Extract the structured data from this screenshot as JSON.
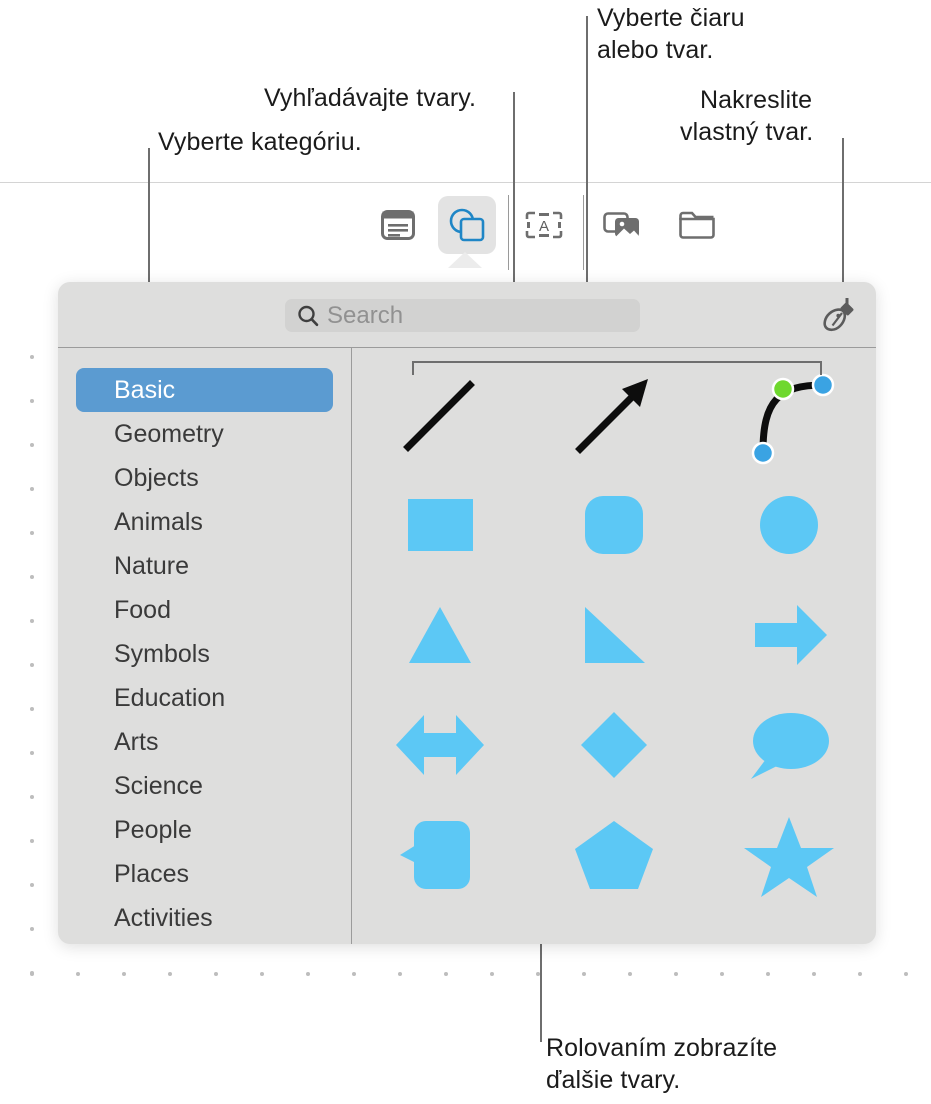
{
  "annotations": {
    "select_category": "Vyberte kategóriu.",
    "search_shapes": "Vyhľadávajte tvary.",
    "select_line_or_shape_l1": "Vyberte čiaru",
    "select_line_or_shape_l2": "alebo tvar.",
    "draw_custom_l1": "Nakreslite",
    "draw_custom_l2": "vlastný tvar.",
    "scroll_more_l1": "Rolovaním zobrazíte",
    "scroll_more_l2": "ďalšie tvary."
  },
  "toolbar": {
    "buttons": [
      {
        "name": "text-button",
        "icon": "text-box-icon",
        "selected": false
      },
      {
        "name": "shape-button",
        "icon": "shapes-icon",
        "selected": true
      },
      {
        "name": "text-box-button",
        "icon": "text-frame-icon",
        "selected": false
      },
      {
        "name": "media-button",
        "icon": "media-icon",
        "selected": false
      },
      {
        "name": "collections-button",
        "icon": "folder-icon",
        "selected": false
      }
    ]
  },
  "panel": {
    "search": {
      "placeholder": "Search",
      "value": "",
      "icon": "search-icon"
    },
    "draw_tool": {
      "name": "draw-shape-button",
      "icon": "pen-nib-icon"
    },
    "sidebar": {
      "items": [
        {
          "label": "Basic",
          "selected": true
        },
        {
          "label": "Geometry",
          "selected": false
        },
        {
          "label": "Objects",
          "selected": false
        },
        {
          "label": "Animals",
          "selected": false
        },
        {
          "label": "Nature",
          "selected": false
        },
        {
          "label": "Food",
          "selected": false
        },
        {
          "label": "Symbols",
          "selected": false
        },
        {
          "label": "Education",
          "selected": false
        },
        {
          "label": "Arts",
          "selected": false
        },
        {
          "label": "Science",
          "selected": false
        },
        {
          "label": "People",
          "selected": false
        },
        {
          "label": "Places",
          "selected": false
        },
        {
          "label": "Activities",
          "selected": false
        }
      ]
    },
    "shapes": {
      "rows": [
        [
          "line-shape",
          "arrow-shape",
          "bezier-curve-shape"
        ],
        [
          "square-shape",
          "rounded-square-shape",
          "circle-shape"
        ],
        [
          "triangle-shape",
          "right-triangle-shape",
          "right-arrow-shape"
        ],
        [
          "double-arrow-shape",
          "diamond-shape",
          "speech-bubble-shape"
        ],
        [
          "callout-rounded-rect-shape",
          "pentagon-shape",
          "star-shape"
        ]
      ]
    }
  },
  "colors": {
    "shape_fill": "#5cc8f5",
    "selection_blue": "#3aa3e3",
    "selection_green": "#6fd82e",
    "sidebar_selected": "#5b9bd1",
    "panel_background": "#dededd",
    "toolbar_selected": "#e3e3e3",
    "accent_outline": "#1f86c6"
  }
}
